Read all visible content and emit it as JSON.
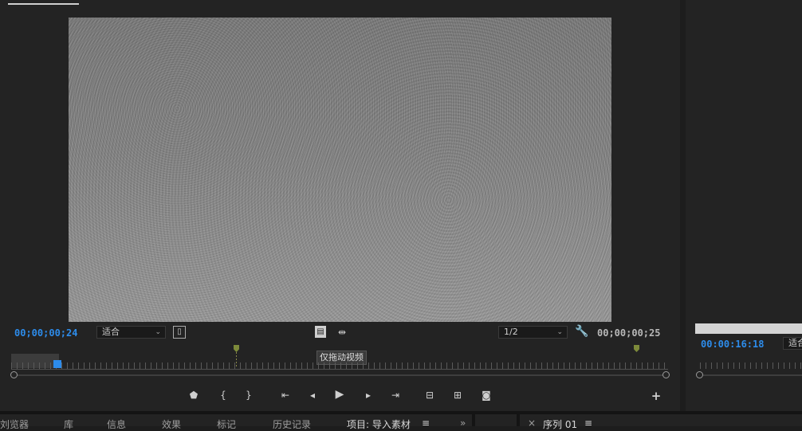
{
  "source_monitor": {
    "current_time": "00;00;00;24",
    "duration": "00;00;00;25",
    "zoom": "适合",
    "resolution": "1/2",
    "tooltip": "仅拖动视频",
    "playhead_fraction": 0.07
  },
  "program_monitor": {
    "current_time": "00:00:16:18",
    "zoom": "适合"
  },
  "bottom_tabs": {
    "items": [
      "刘览器",
      "库",
      "信息",
      "效果",
      "标记",
      "历史记录",
      "项目: 导入素材",
      "≡",
      "»"
    ],
    "sequence_label": "序列 01",
    "sequence_menu": "≡"
  },
  "icons": {
    "settings": "wrench-icon",
    "export_frame": "camera-icon",
    "add_button": "plus-icon"
  }
}
